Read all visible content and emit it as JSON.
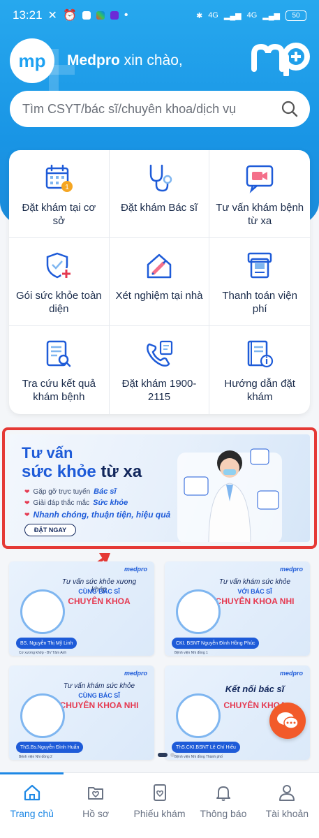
{
  "status": {
    "time": "13:21",
    "signal1": "4G",
    "signal2": "4G",
    "battery": "50"
  },
  "header": {
    "brand": "Medpro",
    "greeting": "xin chào,",
    "logo_text": "mp"
  },
  "search": {
    "placeholder": "Tìm CSYT/bác sĩ/chuyên khoa/dịch vụ"
  },
  "services": [
    {
      "label": "Đặt khám tại cơ sở",
      "icon": "calendar-icon",
      "badge": "1"
    },
    {
      "label": "Đặt khám Bác sĩ",
      "icon": "stethoscope-icon"
    },
    {
      "label": "Tư vấn khám bệnh từ xa",
      "icon": "video-call-icon"
    },
    {
      "label": "Gói sức khỏe toàn diện",
      "icon": "shield-plus-icon"
    },
    {
      "label": "Xét nghiệm tại nhà",
      "icon": "syringe-house-icon"
    },
    {
      "label": "Thanh toán viện phí",
      "icon": "payment-icon"
    },
    {
      "label": "Tra cứu kết quả khám bệnh",
      "icon": "document-search-icon"
    },
    {
      "label": "Đặt khám 1900-2115",
      "icon": "phone-icon"
    },
    {
      "label": "Hướng dẫn đặt khám",
      "icon": "guide-book-icon"
    }
  ],
  "banner": {
    "title_line1": "Tư vấn",
    "title_line2a": "sức khỏe",
    "title_line2b": "từ xa",
    "bullet1_prefix": "Gặp gỡ trực tuyến",
    "bullet1_highlight": "Bác sĩ",
    "bullet2_prefix": "Giải đáp thắc mắc",
    "bullet2_highlight": "Sức khỏe",
    "bullet3": "Nhanh chóng, thuận tiện, hiệu quả",
    "cta": "ĐẶT NGAY"
  },
  "cards": [
    {
      "brand": "medpro",
      "top": "Tư vấn sức khỏe xương khớp",
      "mid": "CÙNG BÁC SĨ",
      "main": "CHUYÊN KHOA",
      "name": "BS. Nguyễn Thị Mỹ Linh",
      "sub": "Cơ xương khớp - BV Tâm Anh"
    },
    {
      "brand": "medpro",
      "top": "Tư vấn khám sức khỏe",
      "mid": "VỚI BÁC SĨ",
      "main": "CHUYÊN KHOA NHI",
      "name": "CKI. BSNT Nguyễn Đình Hồng Phúc",
      "sub": "Bệnh viện Nhi đồng 1"
    },
    {
      "brand": "medpro",
      "top": "Tư vấn khám sức khỏe",
      "mid": "CÙNG BÁC SĨ",
      "main": "CHUYÊN KHOA NHI",
      "name": "ThS.Bs.Nguyễn Đình Huấn",
      "sub": "Bệnh viện Nhi đồng 2"
    },
    {
      "brand": "medpro",
      "top": "Kết nối bác sĩ",
      "mid": "",
      "main": "CHUYÊN KHOA",
      "name": "ThS.CKI.BSNT Lê Chí Hiếu",
      "sub": "Bệnh viện Nhi đồng Thành phố"
    }
  ],
  "nav": [
    {
      "label": "Trang chủ",
      "icon": "home-icon",
      "active": true
    },
    {
      "label": "Hồ sơ",
      "icon": "profile-folder-icon"
    },
    {
      "label": "Phiếu khám",
      "icon": "ticket-icon"
    },
    {
      "label": "Thông báo",
      "icon": "bell-icon"
    },
    {
      "label": "Tài khoản",
      "icon": "user-icon"
    }
  ],
  "colors": {
    "primary": "#1995e5",
    "accent_red": "#e53935",
    "chat": "#f25a2a"
  }
}
